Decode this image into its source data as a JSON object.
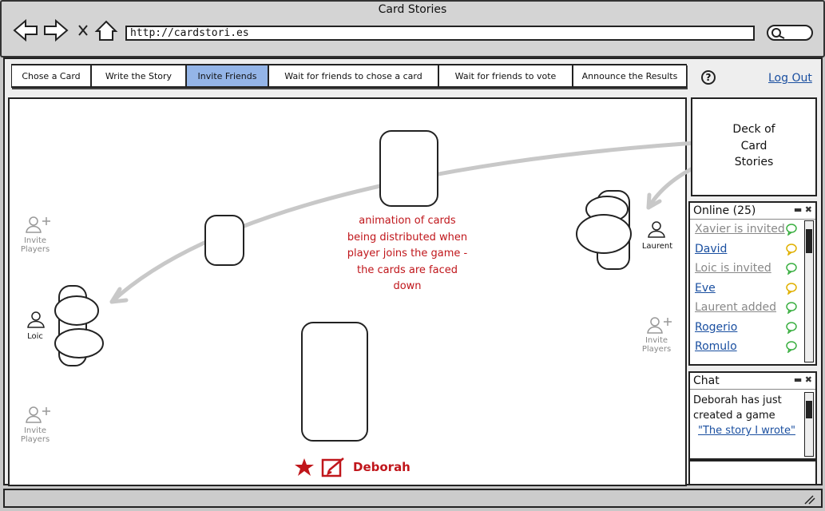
{
  "window": {
    "title": "Card Stories",
    "url": "http://cardstori.es"
  },
  "tabs": [
    {
      "label": "Chose a Card",
      "active": false
    },
    {
      "label": "Write the Story",
      "active": false
    },
    {
      "label": "Invite Friends",
      "active": true
    },
    {
      "label": "Wait for friends to chose a card",
      "active": false
    },
    {
      "label": "Wait for friends to vote",
      "active": false
    },
    {
      "label": "Announce the Results",
      "active": false
    }
  ],
  "header": {
    "help_label": "?",
    "logout_label": "Log Out"
  },
  "board": {
    "animation_note": [
      "animation of cards",
      "being distributed when",
      "player joins the game -",
      "the cards are faced",
      "down"
    ],
    "invite_label": [
      "Invite",
      "Players"
    ],
    "players": {
      "loic": "Loic",
      "laurent": "Laurent"
    },
    "current_player": "Deborah"
  },
  "deck": {
    "label": [
      "Deck of",
      "Card",
      "Stories"
    ]
  },
  "online": {
    "title": "Online (25)",
    "items": [
      {
        "text": "Xavier is invited",
        "muted": true,
        "bubble": "green"
      },
      {
        "text": "David",
        "muted": false,
        "bubble": "yellow"
      },
      {
        "text": "Loic is invited",
        "muted": true,
        "bubble": "green"
      },
      {
        "text": "Eve",
        "muted": false,
        "bubble": "yellow"
      },
      {
        "text": "Laurent added",
        "muted": true,
        "bubble": "green"
      },
      {
        "text": "Rogerio",
        "muted": false,
        "bubble": "green"
      },
      {
        "text": "Romulo",
        "muted": false,
        "bubble": "green"
      }
    ]
  },
  "chat": {
    "title": "Chat",
    "message": "Deborah has just created a game",
    "link": "\"The story I wrote\""
  },
  "colors": {
    "accent_tab": "#94b5e8",
    "link": "#1a4fa0",
    "alert_red": "#c0161b",
    "bubble_green": "#3cb043",
    "bubble_yellow": "#e0b000"
  }
}
